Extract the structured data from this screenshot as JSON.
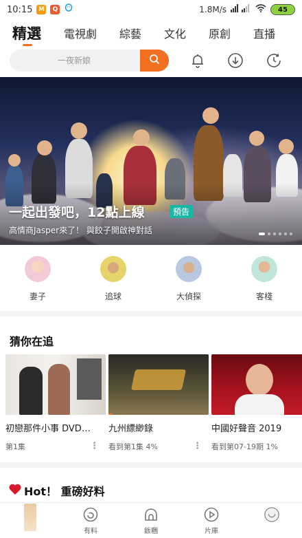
{
  "status_bar": {
    "time": "10:15",
    "app_badges": [
      "M",
      "Q",
      ""
    ],
    "net_speed": "1.8M/s",
    "battery": "45"
  },
  "nav": {
    "tabs": [
      "精選",
      "電視劇",
      "綜藝",
      "文化",
      "原創",
      "直播"
    ],
    "active_index": 0
  },
  "search": {
    "placeholder": "一夜新娘"
  },
  "top_icons": [
    "bell-icon",
    "download-icon",
    "history-icon"
  ],
  "banner": {
    "title": "一起出發吧，12點上線",
    "badge": "預告",
    "subtitle": "高情商Jasper來了！ 與餃子開啟神對話",
    "dot_count": 6,
    "active_dot": 0
  },
  "quick_channels": [
    {
      "label": "妻子"
    },
    {
      "label": "追球"
    },
    {
      "label": "大偵探"
    },
    {
      "label": "客棧"
    }
  ],
  "continue_watching": {
    "title": "猜你在追",
    "items": [
      {
        "title": "初戀那件小事 DVD…",
        "meta": "第1集",
        "progress": 0.0
      },
      {
        "title": "九州縹緲錄",
        "meta": "看到第1集 4%",
        "progress": 0.04
      },
      {
        "title": "中國好聲音 2019",
        "meta": "看到第07-19期 1%",
        "progress": 0.01
      }
    ]
  },
  "hot_section": {
    "title": "Hot！ 重磅好料"
  },
  "bottom_nav": [
    {
      "label": "",
      "icon": "home-icon"
    },
    {
      "label": "有料",
      "icon": "youliao-icon"
    },
    {
      "label": "飯糰",
      "icon": "fantuan-icon"
    },
    {
      "label": "片庫",
      "icon": "play-icon"
    },
    {
      "label": "",
      "icon": "profile-icon"
    }
  ],
  "colors": {
    "accent": "#f37021",
    "badge": "#19b7a6"
  }
}
